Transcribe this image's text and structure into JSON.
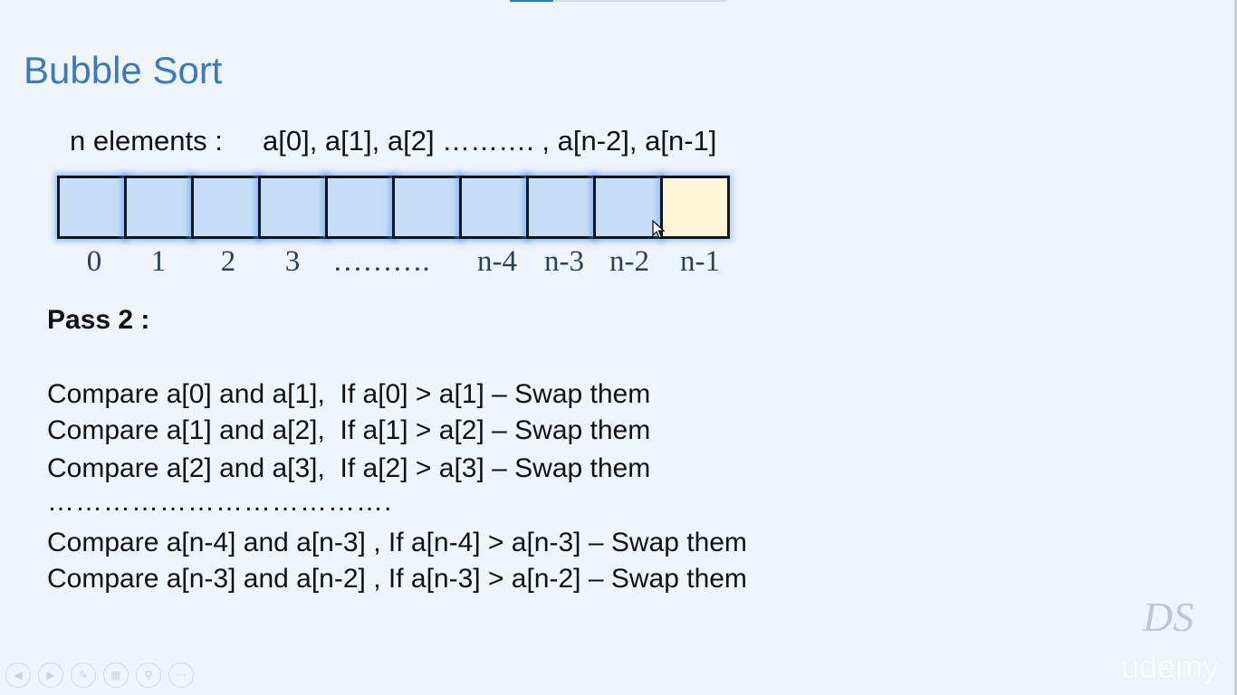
{
  "slide": {
    "title": "Bubble Sort",
    "elements_label": "n elements :",
    "elements_list": "a[0], a[1], a[2] ………. , a[n-2], a[n-1]",
    "array": {
      "indices": [
        "0",
        "1",
        "2",
        "3",
        "……….",
        "n-4",
        "n-3",
        "n-2",
        "n-1"
      ],
      "colors": {
        "unsorted": "#c7def6",
        "sorted": "#fdf6d8",
        "glow": "#5a96f0"
      }
    },
    "pass_heading": "Pass 2 :",
    "comparisons": [
      "Compare a[0] and a[1],  If a[0] > a[1] – Swap them",
      "Compare a[1] and a[2],  If a[1] > a[2] – Swap them",
      "Compare a[2] and a[3],  If a[2] > a[3] – Swap them",
      "Compare a[n-4] and a[n-3] , If a[n-4] > a[n-3] – Swap them",
      "Compare a[n-3] and a[n-2] , If a[n-3] > a[n-2] – Swap them"
    ],
    "ellipsis_line": "………………………………."
  },
  "player": {
    "controls": [
      {
        "name": "previous-icon",
        "glyph": "◀"
      },
      {
        "name": "next-icon",
        "glyph": "▶"
      },
      {
        "name": "pen-icon",
        "glyph": "✎"
      },
      {
        "name": "slides-grid-icon",
        "glyph": "▦"
      },
      {
        "name": "zoom-icon",
        "glyph": "⚲"
      },
      {
        "name": "more-options-icon",
        "glyph": "⋯"
      }
    ]
  },
  "branding": {
    "logo_text": "DS",
    "watermark": "udemy"
  }
}
